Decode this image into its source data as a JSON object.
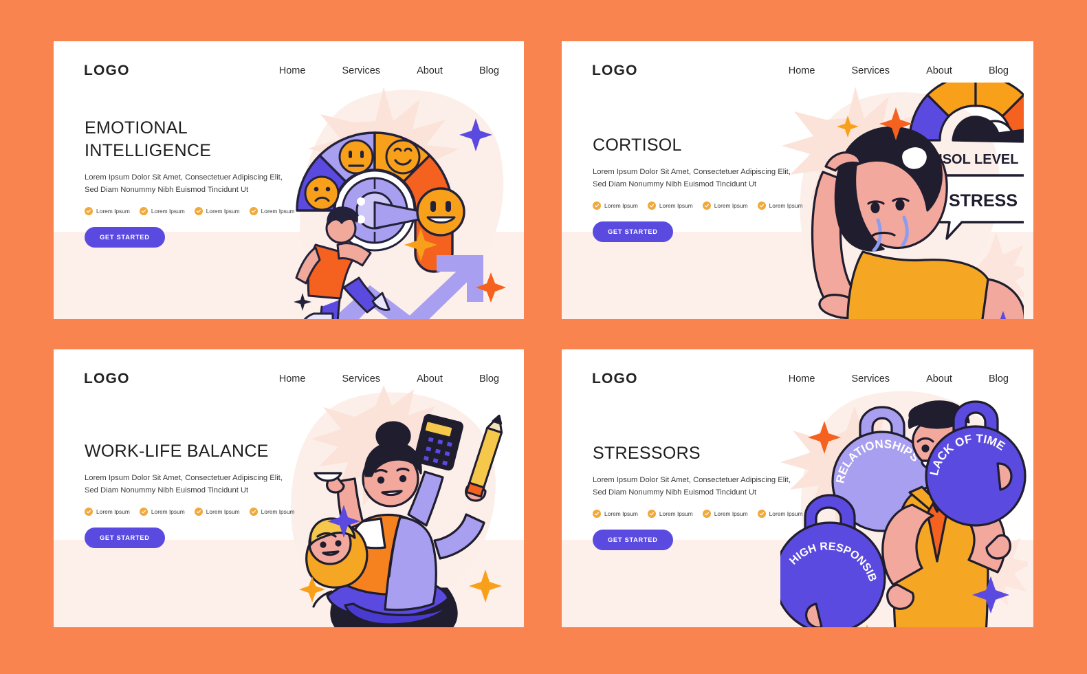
{
  "background_color": "#fa8450",
  "accent_purple": "#5b4ae0",
  "accent_orange": "#f5821f",
  "panels": [
    {
      "id": "emotional-intelligence",
      "logo": "LOGO",
      "nav": [
        "Home",
        "Services",
        "About",
        "Blog"
      ],
      "title": "EMOTIONAL\nINTELLIGENCE",
      "subtitle": "Lorem Ipsum Dolor Sit Amet, Consectetuer Adipiscing Elit, Sed Diam Nonummy Nibh Euismod Tincidunt Ut",
      "features": [
        "Lorem Ipsum",
        "Lorem Ipsum",
        "Lorem Ipsum",
        "Lorem Ipsum"
      ],
      "cta": "GET STARTED",
      "illustration": {
        "name": "emotion-meter-man-climbing-arrow",
        "labels": []
      }
    },
    {
      "id": "cortisol",
      "logo": "LOGO",
      "nav": [
        "Home",
        "Services",
        "About",
        "Blog"
      ],
      "title": "CORTISOL",
      "subtitle": "Lorem Ipsum Dolor Sit Amet, Consectetuer Adipiscing Elit, Sed Diam Nonummy Nibh Euismod Tincidunt Ut",
      "features": [
        "Lorem Ipsum",
        "Lorem Ipsum",
        "Lorem Ipsum",
        "Lorem Ipsum"
      ],
      "cta": "GET STARTED",
      "illustration": {
        "name": "crying-woman-with-cortisol-gauge",
        "labels": [
          "CORTISOL LEVEL",
          "STRESS"
        ]
      }
    },
    {
      "id": "work-life-balance",
      "logo": "LOGO",
      "nav": [
        "Home",
        "Services",
        "About",
        "Blog"
      ],
      "title": "WORK-LIFE BALANCE",
      "subtitle": "Lorem Ipsum Dolor Sit Amet, Consectetuer Adipiscing Elit, Sed Diam Nonummy Nibh Euismod Tincidunt Ut",
      "features": [
        "Lorem Ipsum",
        "Lorem Ipsum",
        "Lorem Ipsum",
        "Lorem Ipsum"
      ],
      "cta": "GET STARTED",
      "illustration": {
        "name": "multitasking-mother-with-baby-calculator-pencil-cup",
        "labels": []
      }
    },
    {
      "id": "stressors",
      "logo": "LOGO",
      "nav": [
        "Home",
        "Services",
        "About",
        "Blog"
      ],
      "title": "STRESSORS",
      "subtitle": "Lorem Ipsum Dolor Sit Amet, Consectetuer Adipiscing Elit, Sed Diam Nonummy Nibh Euismod Tincidunt Ut",
      "features": [
        "Lorem Ipsum",
        "Lorem Ipsum",
        "Lorem Ipsum",
        "Lorem Ipsum"
      ],
      "cta": "GET STARTED",
      "illustration": {
        "name": "man-holding-kettlebells",
        "labels": [
          "HIGH RESPONSIBILITY",
          "RELATIONSHIPS",
          "LACK OF TIME"
        ]
      }
    }
  ]
}
